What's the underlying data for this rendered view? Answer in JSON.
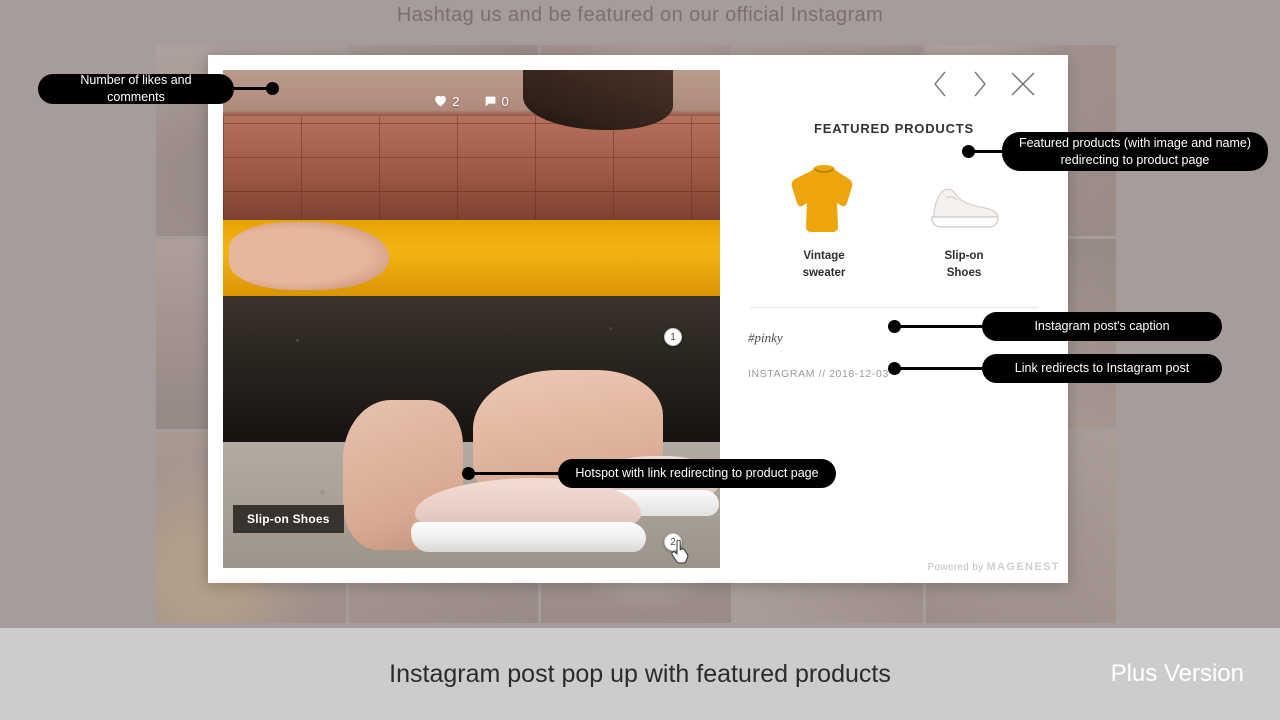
{
  "feed": {
    "heading": "Hashtag us and be featured on our official Instagram"
  },
  "modal": {
    "engagement": {
      "likes": "2",
      "comments": "0",
      "like_icon": "heart-icon",
      "comment_icon": "comment-bubble-icon"
    },
    "nav": {
      "prev_icon": "chevron-left-icon",
      "next_icon": "chevron-right-icon",
      "close_icon": "close-icon"
    },
    "hotspots": [
      {
        "label": "1"
      },
      {
        "label": "2"
      }
    ],
    "hotspot_tooltip": "Slip-on Shoes",
    "featured_title": "FEATURED PRODUCTS",
    "products": [
      {
        "name": "Vintage\nsweater",
        "thumb": "sweater-thumbnail"
      },
      {
        "name": "Slip-on\nShoes",
        "thumb": "shoe-thumbnail"
      }
    ],
    "caption": "#pinky",
    "source": "INSTAGRAM // 2018-12-03",
    "powered_by_prefix": "Powered by ",
    "powered_by_brand": "MAGENEST"
  },
  "annotations": {
    "likes": "Number of likes and comments",
    "products": "Featured products (with image and name)\nredirecting to product page",
    "caption": "Instagram post's caption",
    "source": "Link redirects to Instagram post",
    "hotspot": "Hotspot with link redirecting to product page"
  },
  "footer": {
    "caption": "Instagram post pop up with featured products",
    "version": "Plus Version"
  },
  "colors": {
    "scrim": "#a69c9c",
    "footer_bar": "#cccccc",
    "annotation_bg": "#000000",
    "sweater": "#f0b211"
  }
}
